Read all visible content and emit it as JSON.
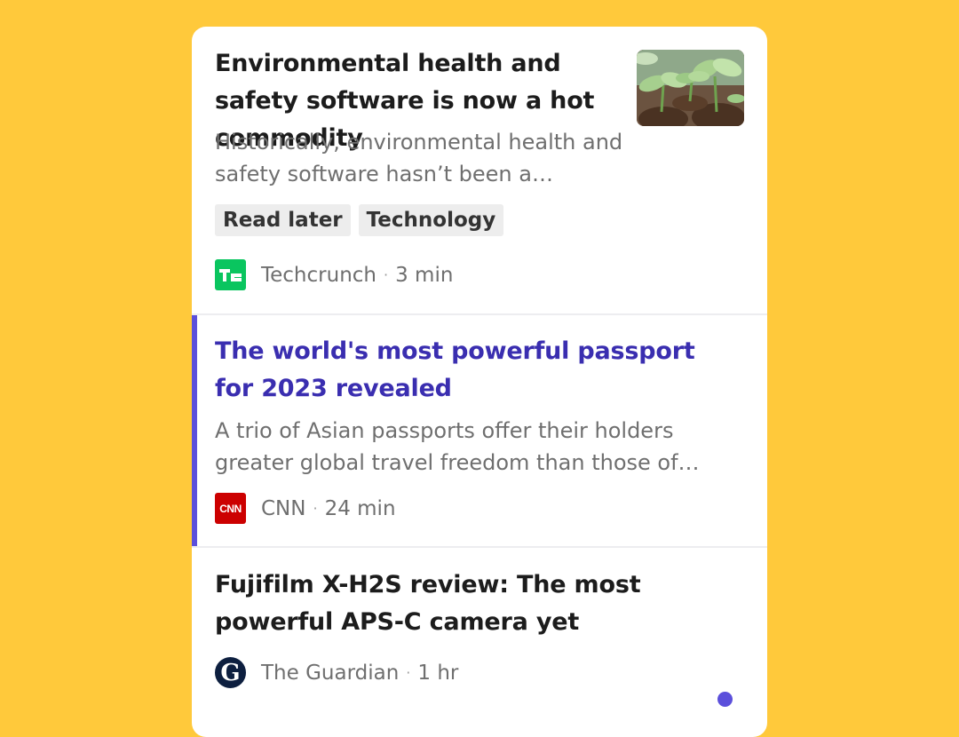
{
  "articles": [
    {
      "title": "Environmental health and safety software is now a hot commodity",
      "summary": "Historically, environmental health and safety software hasn’t been a…",
      "tags": [
        "Read later",
        "Technology"
      ],
      "source": "Techcrunch",
      "read_time": "3 min",
      "logo_text": "TC",
      "thumbnail_icon": "seedlings-photo"
    },
    {
      "title": "The world's most powerful passport for 2023 revealed",
      "summary": "A trio of Asian passports offer their holders greater global travel freedom than those of…",
      "source": "CNN",
      "read_time": "24 min",
      "logo_text": "CNN"
    },
    {
      "title": "Fujifilm X-H2S review: The most powerful APS-C camera yet",
      "source": "The Guardian",
      "read_time": "1 hr",
      "logo_text": "G"
    }
  ],
  "separator": "·",
  "colors": {
    "background": "#FFC93B",
    "accent": "#5B4FDB",
    "active_title": "#3A2EB0",
    "techcrunch": "#0AC55F",
    "cnn": "#CC0000",
    "guardian": "#0D1F3F"
  }
}
